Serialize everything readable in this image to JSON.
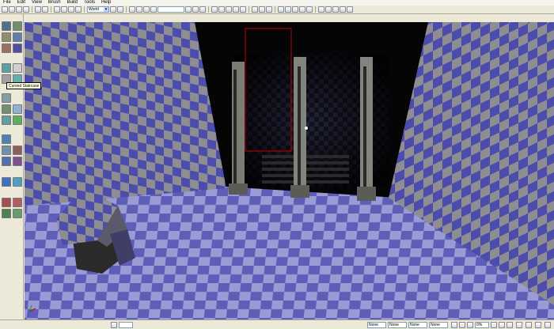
{
  "menu": [
    "File",
    "Edit",
    "View",
    "Brush",
    "Build",
    "Tools",
    "Help"
  ],
  "toolbar": {
    "mode_select": "World"
  },
  "tooltip": "Curved Staircase",
  "status": {
    "fields": [
      "None",
      "None",
      "None",
      "None"
    ],
    "zoom": "0%"
  },
  "icons": {
    "camera": "camera-icon",
    "cube": "cube-brush-icon",
    "stairs": "curved-staircase-icon"
  },
  "colors": {
    "checker_blue": "#4c4cac",
    "checker_grey": "#8e8e92",
    "floor_light": "#9a9ad4",
    "floor_dark": "#5e5eb8"
  }
}
